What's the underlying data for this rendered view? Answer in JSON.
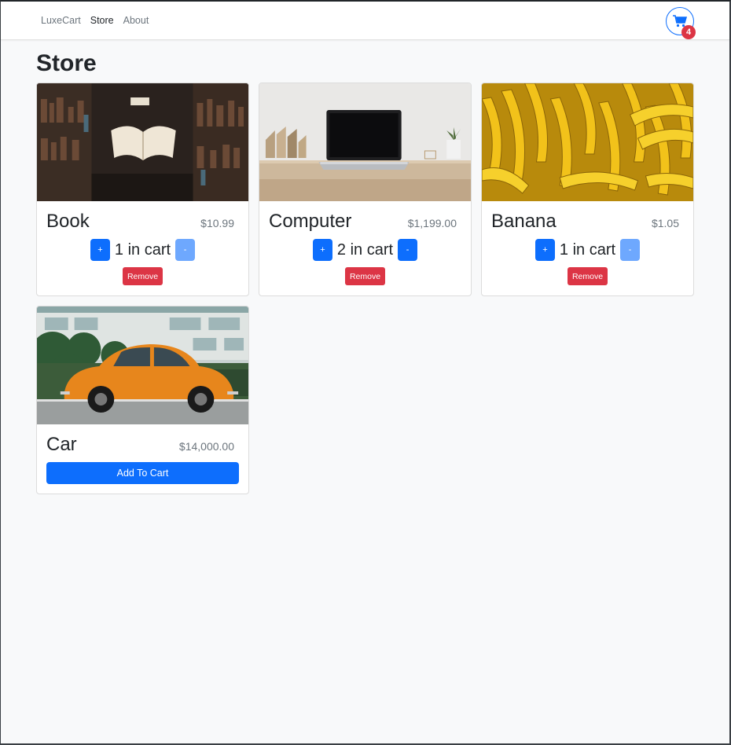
{
  "nav": {
    "brand": "LuxeCart",
    "links": [
      "Store",
      "About"
    ],
    "cart_count": "4",
    "cart_icon": "shopping-cart-icon"
  },
  "page": {
    "title": "Store"
  },
  "products": [
    {
      "name": "Book",
      "price": "$10.99",
      "quantity_text": "1 in cart",
      "plus_label": "+",
      "minus_label": "-",
      "remove_label": "Remove",
      "image": "open-book-library-image"
    },
    {
      "name": "Computer",
      "price": "$1,199.00",
      "quantity_text": "2 in cart",
      "plus_label": "+",
      "minus_label": "-",
      "remove_label": "Remove",
      "image": "laptop-on-desk-image"
    },
    {
      "name": "Banana",
      "price": "$1.05",
      "quantity_text": "1 in cart",
      "plus_label": "+",
      "minus_label": "-",
      "remove_label": "Remove",
      "image": "bananas-image"
    },
    {
      "name": "Car",
      "price": "$14,000.00",
      "add_label": "Add To Cart",
      "image": "orange-beetle-car-image"
    }
  ],
  "colors": {
    "primary": "#0d6efd",
    "primary_disabled": "#6ea8fe",
    "danger": "#dc3545",
    "background": "#f8f9fa"
  }
}
